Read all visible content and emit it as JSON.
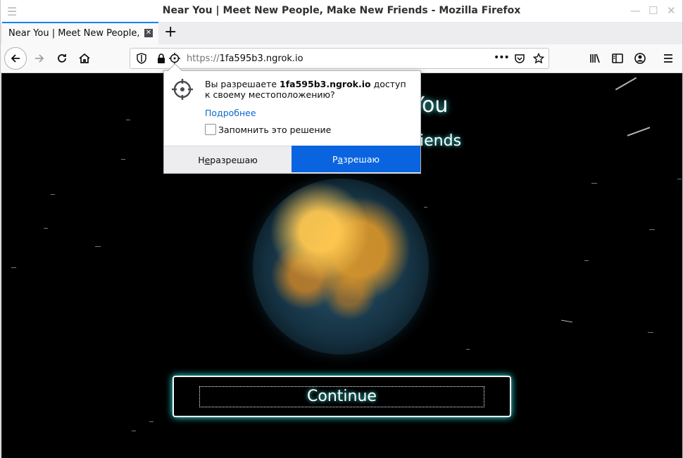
{
  "window": {
    "title": "Near You | Meet New People, Make New Friends - Mozilla Firefox"
  },
  "tab": {
    "title": "Near You | Meet New People, M",
    "close_icon": "close-icon",
    "new_tab_label": "+"
  },
  "toolbar": {
    "url_protocol": "https://",
    "url_host": "1fa595b3.ngrok.io",
    "icons": [
      "back-icon",
      "forward-icon",
      "reload-icon",
      "home-icon",
      "tracking-shield-icon",
      "lock-icon",
      "location-permission-icon",
      "page-actions-icon",
      "pocket-icon",
      "bookmark-star-icon",
      "library-icon",
      "sidebar-icon",
      "account-icon",
      "menu-icon"
    ],
    "page_actions_label": "•••"
  },
  "page": {
    "title_visible": "You",
    "subtitle_visible": "w Friends",
    "continue_label": "Continue"
  },
  "popup": {
    "message_prefix": "Вы разрешаете ",
    "message_host": "1fa595b3.ngrok.io",
    "message_suffix": " доступ к своему местоположению?",
    "learn_more": "Подробнее",
    "remember_label": "Запомнить это решение",
    "deny_prefix": "Н",
    "deny_underlined": "е",
    "deny_suffix": " разрешаю",
    "allow_prefix": "Р",
    "allow_underlined": "а",
    "allow_suffix": "зрешаю"
  },
  "colors": {
    "accent": "#0a84ff",
    "allow_button": "#0a64e0",
    "glow": "#44ffff"
  }
}
